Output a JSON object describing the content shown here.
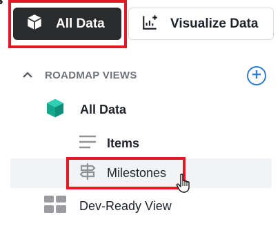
{
  "toolbar": {
    "all_data_label": "All Data",
    "visualize_label": "Visualize Data"
  },
  "section": {
    "title": "ROADMAP VIEWS"
  },
  "tree": {
    "all_data": "All Data",
    "items": "Items",
    "milestones": "Milestones",
    "dev_ready": "Dev-Ready View"
  },
  "icons": {
    "collapse": "chevrons-left-icon",
    "all_data_button": "cube-icon",
    "visualize_button": "chart-plus-icon",
    "section_toggle": "chevron-up-icon",
    "add": "plus-circle-icon",
    "all_data_tree": "cube-icon",
    "items_tree": "lines-icon",
    "milestones_tree": "signpost-icon",
    "dev_ready_tree": "grid-icon",
    "cursor": "hand-pointer-icon"
  },
  "colors": {
    "highlight": "#e01b24",
    "primary_button_bg": "#2a2b2d",
    "accent_blue": "#2f7bd1",
    "teal_cube": "#17b39a",
    "hover_row": "#f2f3f4"
  }
}
